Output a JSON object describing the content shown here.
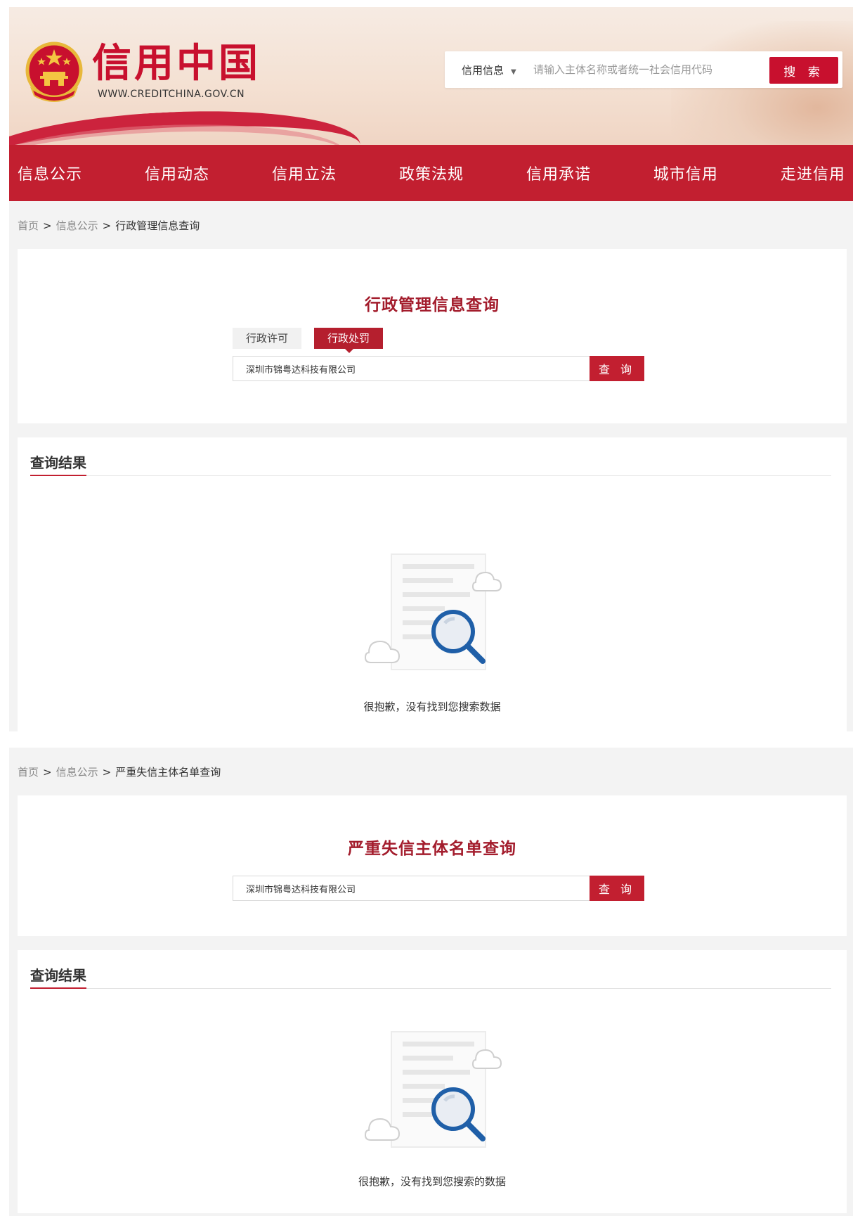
{
  "header": {
    "brand_title": "信用中国",
    "brand_url": "WWW.CREDITCHINA.GOV.CN",
    "search": {
      "category": "信用信息",
      "placeholder": "请输入主体名称或者统一社会信用代码",
      "button_label": "搜 索"
    }
  },
  "nav": {
    "items": [
      "信息公示",
      "信用动态",
      "信用立法",
      "政策法规",
      "信用承诺",
      "城市信用",
      "走进信用"
    ]
  },
  "section1": {
    "breadcrumb": {
      "home": "首页",
      "sep": ">",
      "parent": "信息公示",
      "current": "行政管理信息查询"
    },
    "title": "行政管理信息查询",
    "tabs": [
      "行政许可",
      "行政处罚"
    ],
    "active_tab": "行政处罚",
    "query": {
      "value": "深圳市锦粤达科技有限公司",
      "button_label": "查 询"
    },
    "result_title": "查询结果",
    "empty_text": "很抱歉，没有找到您搜索数据"
  },
  "section2": {
    "breadcrumb": {
      "home": "首页",
      "sep": ">",
      "parent": "信息公示",
      "current": "严重失信主体名单查询"
    },
    "title": "严重失信主体名单查询",
    "query": {
      "value": "深圳市锦粤达科技有限公司",
      "button_label": "查 询"
    },
    "result_title": "查询结果",
    "empty_text": "很抱歉，没有找到您搜索的数据"
  },
  "colors": {
    "brand_red": "#c8102e",
    "nav_red": "#c21f30",
    "title_red": "#a31c2c",
    "illustration_blue": "#1f5fa8"
  }
}
